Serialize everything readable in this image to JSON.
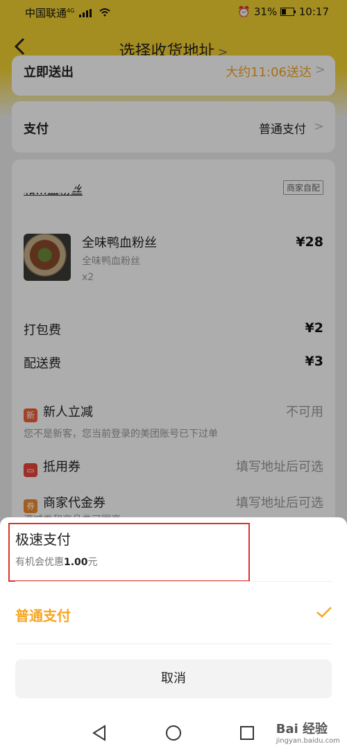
{
  "status": {
    "carrier": "中国联通",
    "net": "4G",
    "battery": "31%",
    "time": "10:17"
  },
  "nav": {
    "title": "选择收货地址"
  },
  "delivery": {
    "label": "立即送出",
    "value": "大约11:06送达"
  },
  "payment": {
    "label": "支付",
    "value": "普通支付"
  },
  "shop": {
    "name": "和…血粉丝",
    "tag": "商家自配"
  },
  "item": {
    "name": "全味鸭血粉丝",
    "spec": "全味鸭血粉丝",
    "qty": "x2",
    "price": "¥28"
  },
  "fees": [
    {
      "label": "打包费",
      "value": "¥2"
    },
    {
      "label": "配送费",
      "value": "¥3"
    }
  ],
  "promos": [
    {
      "icon": "新",
      "label": "新人立减",
      "value": "不可用",
      "note": "您不是新客，您当前登录的美团账号已下过单"
    },
    {
      "icon": "",
      "label": "抵用券",
      "value": "填写地址后可选"
    },
    {
      "icon": "券",
      "label": "商家代金券",
      "value": "填写地址后可选",
      "note": "满减券和商品券可同享"
    }
  ],
  "sheet": {
    "fast_label": "极速支付",
    "fast_prefix": "有机会优惠",
    "fast_amount": "1.00",
    "fast_suffix": "元",
    "normal_label": "普通支付",
    "cancel_label": "取消"
  },
  "watermark": {
    "brand": "Bai 经验",
    "url": "jingyan.baidu.com"
  }
}
